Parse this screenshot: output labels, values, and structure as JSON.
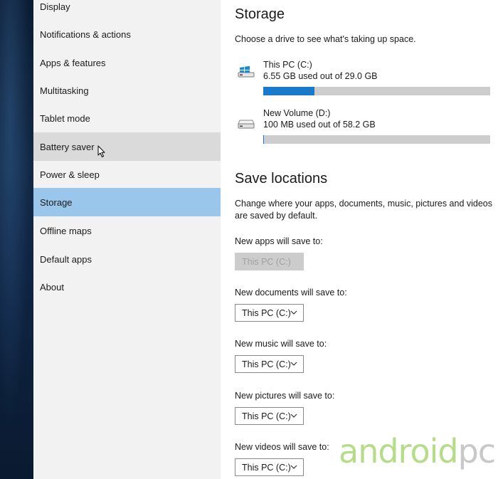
{
  "nav": {
    "items": [
      {
        "label": "Display",
        "state": "normal"
      },
      {
        "label": "Notifications & actions",
        "state": "normal"
      },
      {
        "label": "Apps & features",
        "state": "normal"
      },
      {
        "label": "Multitasking",
        "state": "normal"
      },
      {
        "label": "Tablet mode",
        "state": "normal"
      },
      {
        "label": "Battery saver",
        "state": "hover"
      },
      {
        "label": "Power & sleep",
        "state": "normal"
      },
      {
        "label": "Storage",
        "state": "selected"
      },
      {
        "label": "Offline maps",
        "state": "normal"
      },
      {
        "label": "Default apps",
        "state": "normal"
      },
      {
        "label": "About",
        "state": "normal"
      }
    ]
  },
  "storage": {
    "title": "Storage",
    "description": "Choose a drive to see what's taking up space.",
    "drives": [
      {
        "name": "This PC (C:)",
        "usage": "6.55 GB used out of 29.0 GB",
        "used_fraction": 0.2259,
        "icon": "windows-drive-icon"
      },
      {
        "name": "New Volume (D:)",
        "usage": "100 MB used out of 58.2 GB",
        "used_fraction": 0.0017,
        "icon": "drive-icon"
      }
    ]
  },
  "save_locations": {
    "title": "Save locations",
    "description_line1": "Change where your apps, documents, music, pictures and videos",
    "description_line2": "are saved by default.",
    "settings": [
      {
        "label": "New apps will save to:",
        "value": "This PC (C:)",
        "disabled": true
      },
      {
        "label": "New documents will save to:",
        "value": "This PC (C:)",
        "disabled": false
      },
      {
        "label": "New music will save to:",
        "value": "This PC (C:)",
        "disabled": false
      },
      {
        "label": "New pictures will save to:",
        "value": "This PC (C:)",
        "disabled": false
      },
      {
        "label": "New videos will save to:",
        "value": "This PC (C:)",
        "disabled": false
      }
    ]
  },
  "watermark": {
    "part1": "android",
    "part2": "pc"
  },
  "colors": {
    "accent": "#1979ca",
    "selected": "#99c6ea",
    "hover": "#dadada",
    "nav_bg": "#f2f2f2",
    "bar_bg": "#cdcdcd"
  }
}
